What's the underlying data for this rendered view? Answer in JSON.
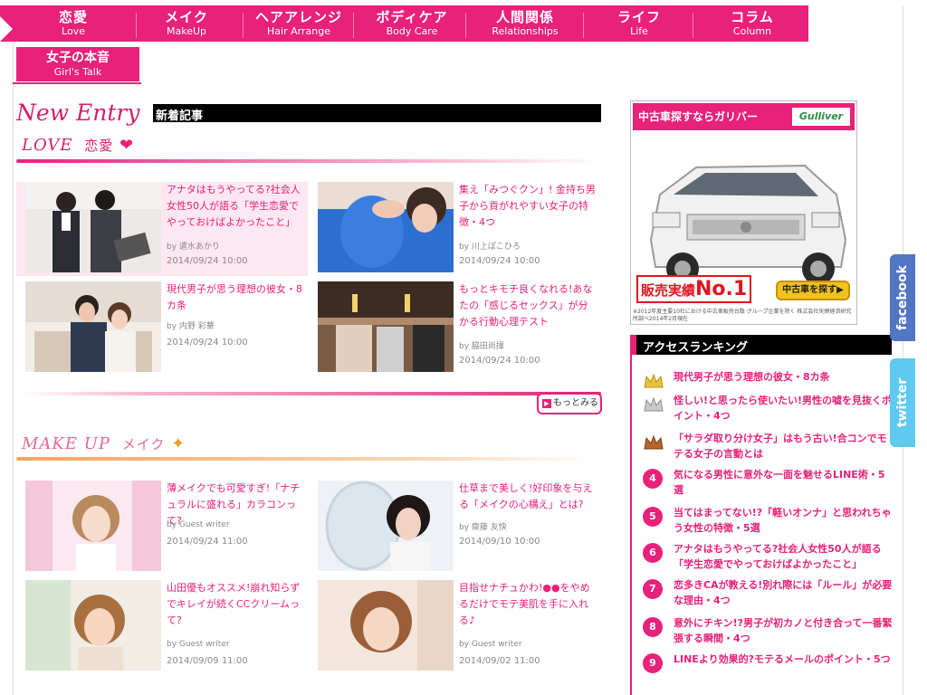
{
  "nav": {
    "items": [
      {
        "jp": "恋愛",
        "en": "Love"
      },
      {
        "jp": "メイク",
        "en": "MakeUp"
      },
      {
        "jp": "ヘアアレンジ",
        "en": "Hair Arrange"
      },
      {
        "jp": "ボディケア",
        "en": "Body Care"
      },
      {
        "jp": "人間関係",
        "en": "Relationships"
      },
      {
        "jp": "ライフ",
        "en": "Life"
      },
      {
        "jp": "コラム",
        "en": "Column"
      }
    ]
  },
  "girls_tab": {
    "jp": "女子の本音",
    "en": "Girl's Talk"
  },
  "new_entry": {
    "script": "New Entry",
    "label": "新着記事"
  },
  "love": {
    "heading_en": "LOVE",
    "heading_jp": "恋愛",
    "articles": [
      {
        "title": "アナタはもうやってる?社会人女性50人が語る「学生恋愛でやっておけばよかったこと」",
        "by": "by 遣水あかり",
        "date": "2014/09/24 10:00"
      },
      {
        "title": "集え「みつぐクン」! 金持ち男子から貢がれやすい女子の特徴・4つ",
        "by": "by 川上ぽこひろ",
        "date": "2014/09/24 10:00"
      },
      {
        "title": "現代男子が思う理想の彼女・8カ条",
        "by": "by 内野 彩華",
        "date": "2014/09/24 10:00"
      },
      {
        "title": "もっとキモチ良くなれる!あなたの「感じるセックス」が分かる行動心理テスト",
        "by": "by 脇田尚揮",
        "date": "2014/09/24 10:00"
      }
    ],
    "more_label": "もっとみる"
  },
  "makeup": {
    "heading_en": "MAKE UP",
    "heading_jp": "メイク",
    "articles": [
      {
        "title": "薄メイクでも可愛すぎ!「ナチュラルに盛れる」カラコンって?",
        "by": "by Guest writer",
        "date": "2014/09/24 11:00"
      },
      {
        "title": "仕草まで美しく!好印象を与える「メイクの心構え」とは?",
        "by": "by 齋藤 友怏",
        "date": "2014/09/10 10:00"
      },
      {
        "title": "山田優もオススメ!崩れ知らずでキレイが続くCCクリームって?",
        "by": "by Guest writer",
        "date": "2014/09/09 11:00"
      },
      {
        "title": "目指せナチュかわ!●●をやめるだけでモテ美肌を手に入れる♪",
        "by": "by Guest writer",
        "date": "2014/09/02 11:00"
      }
    ]
  },
  "ad": {
    "title": "中古車探すならガリバー",
    "logo": "Gulliver",
    "sales_prefix": "販売実績",
    "sales_num": "No.1",
    "search_btn": "中古車を探す▶",
    "note": "※2012年度主要10社における中古車販売台数 グループ企業を除く 株式会社矢野経済研究所調べ2014年2月現在"
  },
  "ranking": {
    "title": "アクセスランキング",
    "items": [
      {
        "rank": "1",
        "title": "現代男子が思う理想の彼女・8カ条"
      },
      {
        "rank": "2",
        "title": "怪しい!と思ったら使いたい!男性の嘘を見抜くポイント・4つ"
      },
      {
        "rank": "3",
        "title": "「サラダ取り分け女子」はもう古い!合コンでモテる女子の言動とは"
      },
      {
        "rank": "4",
        "title": "気になる男性に意外な一面を魅せるLINE術・5選"
      },
      {
        "rank": "5",
        "title": "当てはまってない!?「軽いオンナ」と思われちゃう女性の特徴・5選"
      },
      {
        "rank": "6",
        "title": "アナタはもうやってる?社会人女性50人が語る「学生恋愛でやっておけばよかったこと」"
      },
      {
        "rank": "7",
        "title": "恋多きCAが教える!別れ際には「ルール」が必要な理由・4つ"
      },
      {
        "rank": "8",
        "title": "意外にチキン!?男子が初カノと付き合って一番緊張する瞬間・4つ"
      },
      {
        "rank": "9",
        "title": "LINEより効果的?モテるメールのポイント・5つ"
      }
    ]
  },
  "social": {
    "facebook": "facebook",
    "twitter": "twitter"
  },
  "colors": {
    "accent": "#e8217a",
    "makeup_accent": "#f4a35c"
  }
}
